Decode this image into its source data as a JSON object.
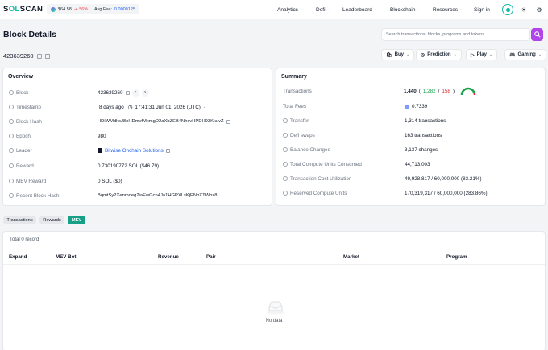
{
  "app": {
    "logo_prefix": "S",
    "logo_accent": "OL",
    "logo_suffix": "SCAN",
    "price": "$64.58",
    "price_change": "-4.56%",
    "avg_fee_label": "Avg Fee:",
    "avg_fee_value": "0.0000125"
  },
  "nav": {
    "items": [
      "Analytics",
      "Defi",
      "Leaderboard",
      "Blockchain",
      "Resources"
    ],
    "signin": "Sign in"
  },
  "page": {
    "title": "Block Details",
    "search_placeholder": "Search transactions, blocks, programs and tokens",
    "block_id": "423639260",
    "actions": [
      "Buy",
      "Prediction",
      "Play",
      "Gaming"
    ]
  },
  "overview": {
    "title": "Overview",
    "rows": [
      {
        "label": "Block",
        "value": "423639260"
      },
      {
        "label": "Timestamp",
        "value": "8 days ago",
        "value2": "17:41:31 Jun 01, 2026 (UTC)"
      },
      {
        "label": "Block Hash",
        "value": "HDiWMdksJ8oHDmvfMxmgD2aXbZEB4NhcvHPDH93KkuvZ"
      },
      {
        "label": "Epoch",
        "value": "980"
      },
      {
        "label": "Leader",
        "value": "Bitwise Onchain Solutions"
      },
      {
        "label": "Reward",
        "value": "0.730190772 SOL ($46.79)"
      },
      {
        "label": "MEV Reward",
        "value": "0 SOL ($0)"
      },
      {
        "label": "Recent Block Hash",
        "value": "BqmtSy2Xenmoeg2iaEwGcn4Ja1HGPXLsKjENbXTWbx8"
      }
    ]
  },
  "summary": {
    "title": "Summary",
    "transactions_total": "1,440",
    "transactions_success": "1,282",
    "transactions_failed": "158",
    "success_ratio": 0.89,
    "rows": [
      {
        "label": "Transactions"
      },
      {
        "label": "Total Fees",
        "value": "0.7339"
      },
      {
        "label": "Transfer",
        "value": "1,314 transactions"
      },
      {
        "label": "Defi swaps",
        "value": "163 transactions"
      },
      {
        "label": "Balance Changes",
        "value": "3,137 changes"
      },
      {
        "label": "Total Compute Units Consumed",
        "value": "44,713,003"
      },
      {
        "label": "Transaction Cost Utilization",
        "value": "49,928,817 / 60,000,000 (83.21%)"
      },
      {
        "label": "Reserved Compute Units",
        "value": "170,319,317 / 60,000,000 (283.86%)"
      }
    ]
  },
  "tabs": [
    "Transactions",
    "Rewards",
    "MEV"
  ],
  "mev_table": {
    "total": "Total 0 record",
    "columns": [
      "Expand",
      "MEV Bot",
      "Revenue",
      "Pair",
      "Market",
      "Program"
    ],
    "empty": "No data"
  },
  "colors": {
    "accent": "#16a085",
    "search_button": "#b145e9",
    "link": "#2563eb",
    "success": "#16a34a",
    "fail": "#dc2626"
  }
}
